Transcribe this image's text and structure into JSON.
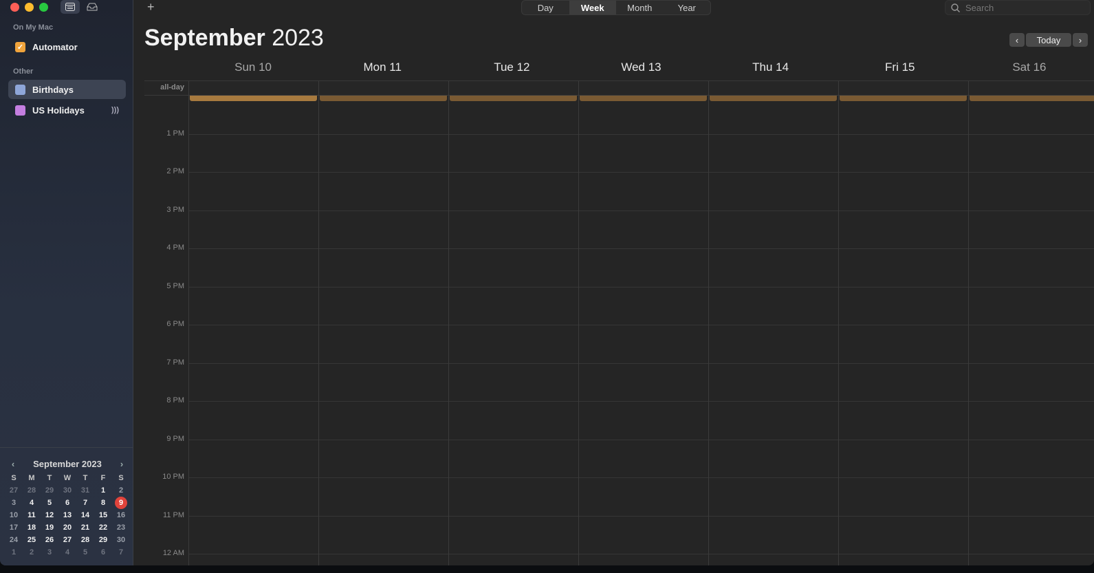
{
  "toolbar": {
    "add_label": "+",
    "views": [
      "Day",
      "Week",
      "Month",
      "Year"
    ],
    "active_view": "Week",
    "search_placeholder": "Search",
    "today_label": "Today"
  },
  "sidebar": {
    "section_on_my_mac": "On My Mac",
    "section_other": "Other",
    "calendars": {
      "automator": {
        "label": "Automator",
        "color": "#f0a43c",
        "checked": true
      },
      "birthdays": {
        "label": "Birthdays",
        "color": "#8ea6d8",
        "checked": false
      },
      "us_holidays": {
        "label": "US Holidays",
        "color": "#c47ee0",
        "checked": false
      }
    }
  },
  "header": {
    "month": "September",
    "year": "2023"
  },
  "days": [
    "Sun 10",
    "Mon 11",
    "Tue 12",
    "Wed 13",
    "Thu 14",
    "Fri 15",
    "Sat 16"
  ],
  "allday_label": "all-day",
  "hours": [
    "1 PM",
    "2 PM",
    "3 PM",
    "4 PM",
    "5 PM",
    "6 PM",
    "7 PM",
    "8 PM",
    "9 PM",
    "10 PM",
    "11 PM",
    "12 AM"
  ],
  "mini_calendar": {
    "title": "September 2023",
    "weekday_headers": [
      "S",
      "M",
      "T",
      "W",
      "T",
      "F",
      "S"
    ],
    "weeks": [
      [
        "27",
        "28",
        "29",
        "30",
        "31",
        "1",
        "2"
      ],
      [
        "3",
        "4",
        "5",
        "6",
        "7",
        "8",
        "9"
      ],
      [
        "10",
        "11",
        "12",
        "13",
        "14",
        "15",
        "16"
      ],
      [
        "17",
        "18",
        "19",
        "20",
        "21",
        "22",
        "23"
      ],
      [
        "24",
        "25",
        "26",
        "27",
        "28",
        "29",
        "30"
      ],
      [
        "1",
        "2",
        "3",
        "4",
        "5",
        "6",
        "7"
      ]
    ],
    "today": "9"
  }
}
